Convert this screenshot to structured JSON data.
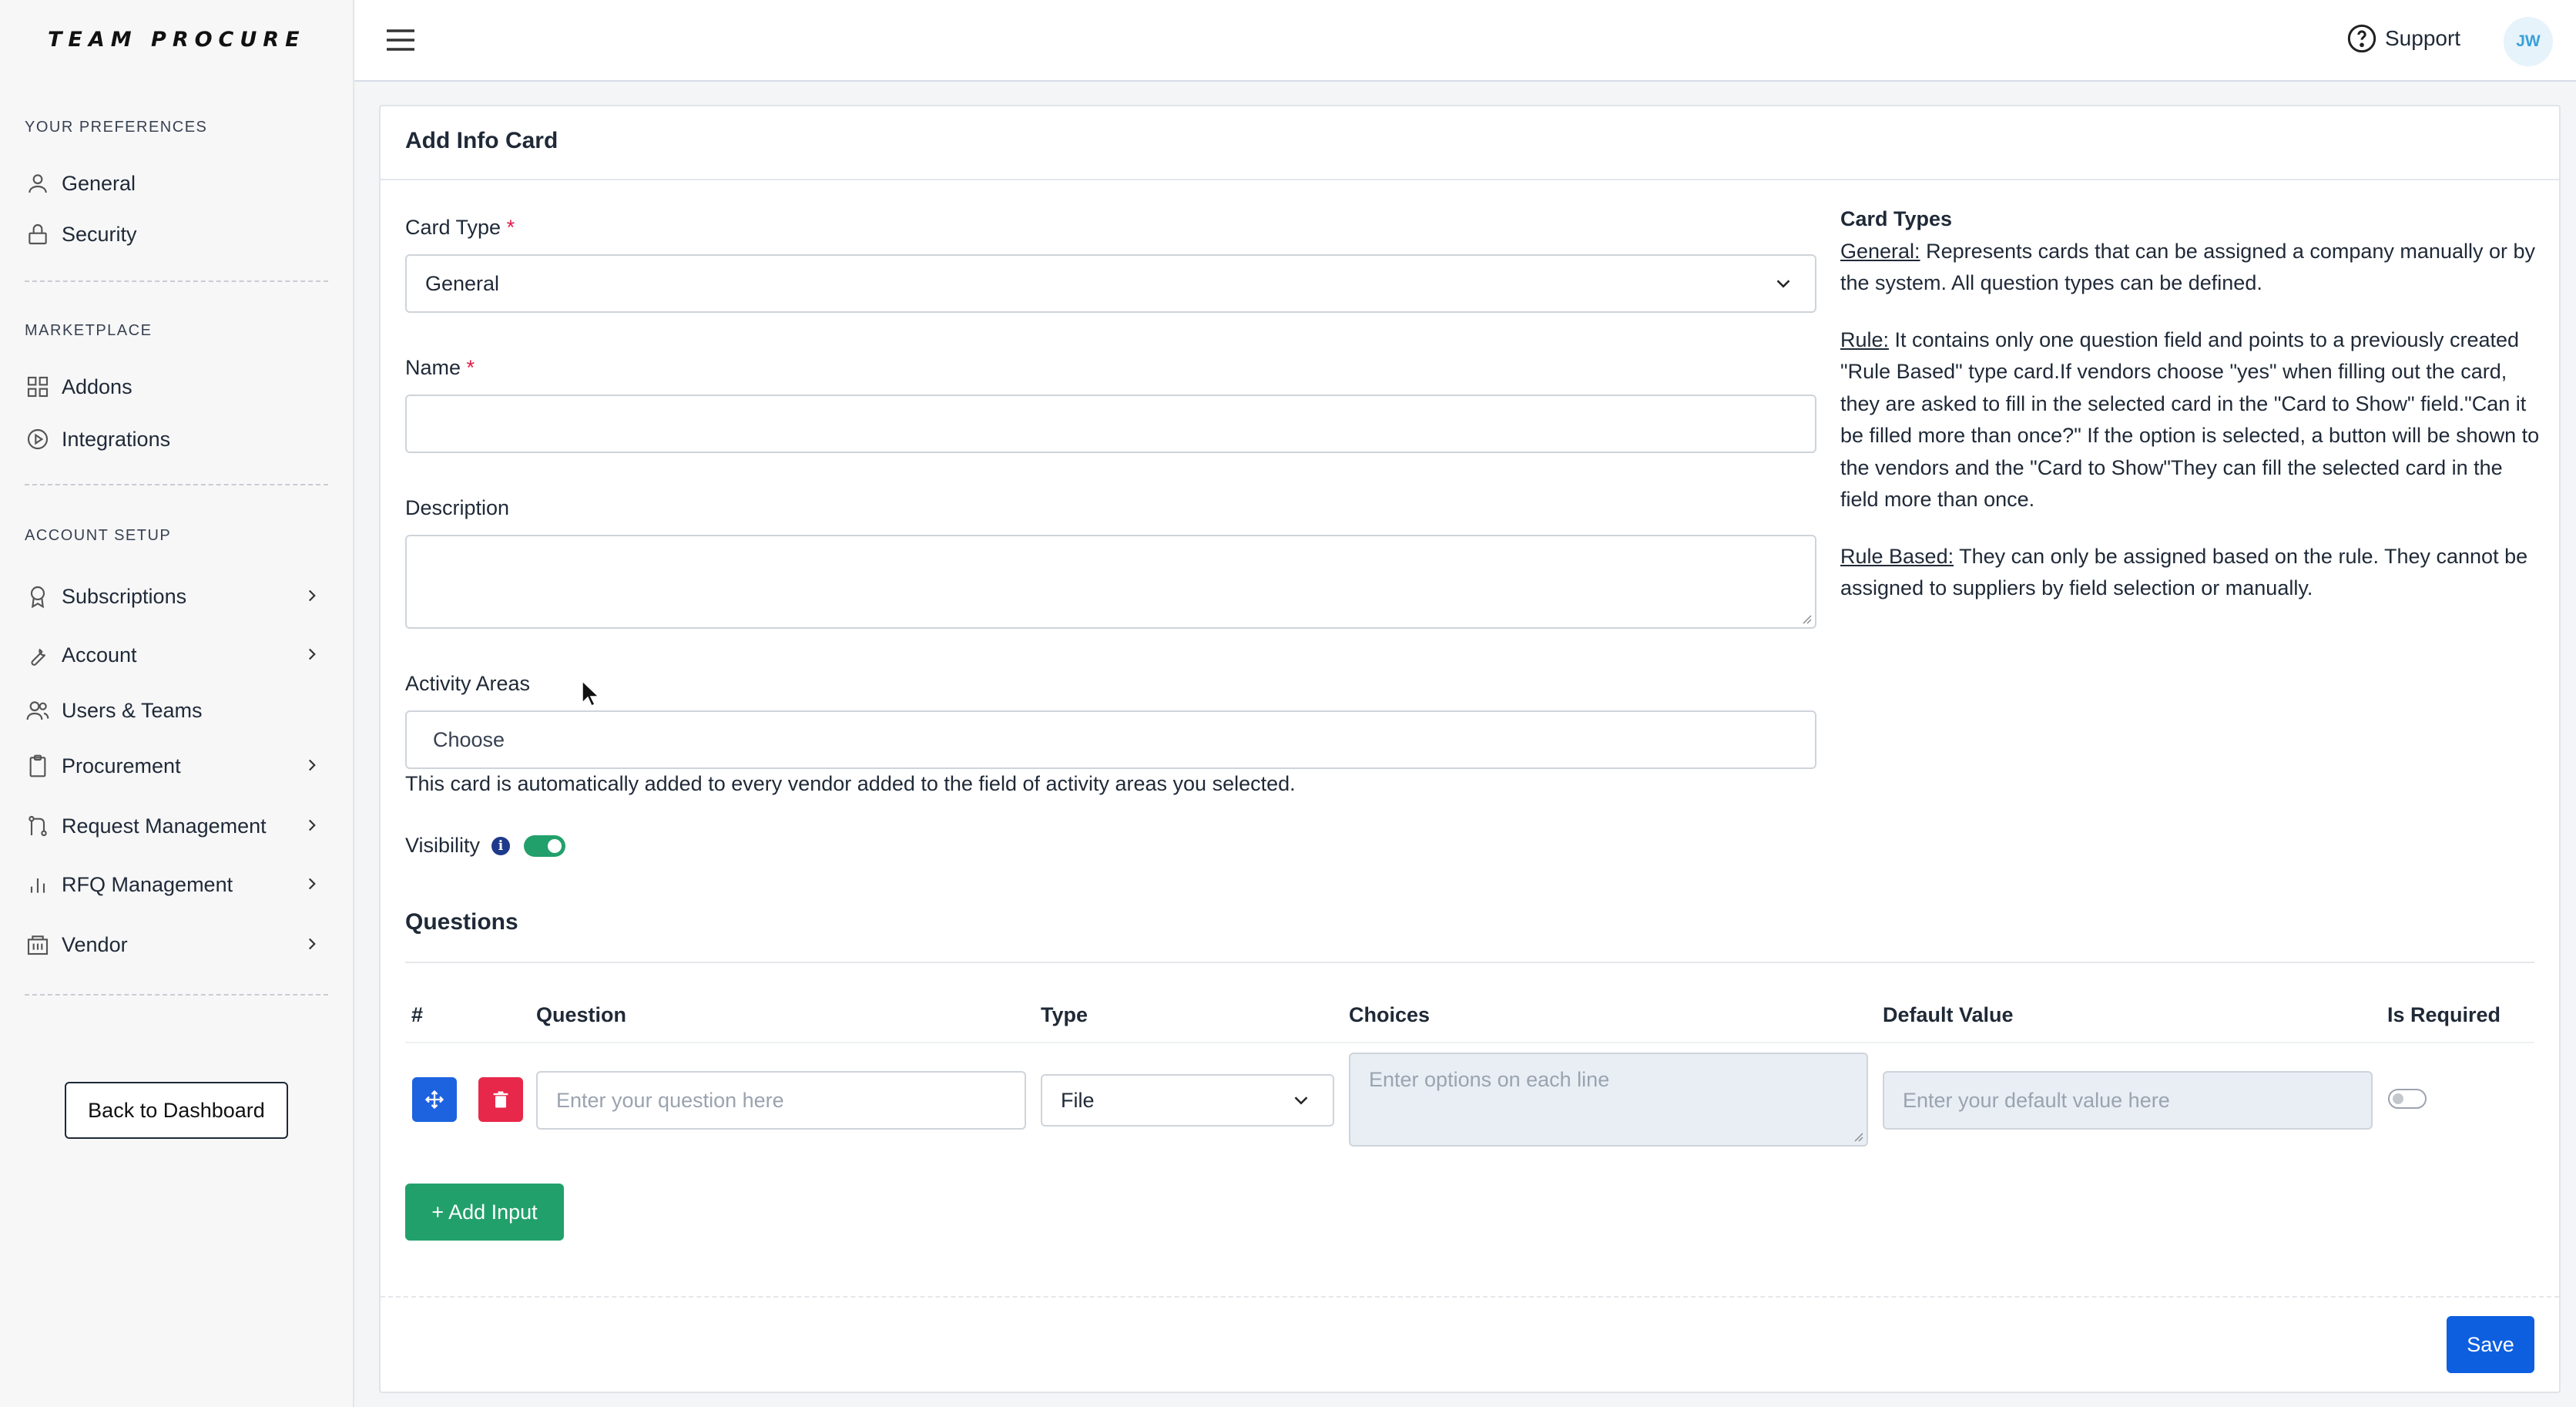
{
  "brand": {
    "logo_text": "TEAM PROCURE"
  },
  "sidebar": {
    "sections": [
      {
        "label": "YOUR PREFERENCES"
      },
      {
        "label": "MARKETPLACE"
      },
      {
        "label": "ACCOUNT SETUP"
      }
    ],
    "items": [
      {
        "label": "General",
        "icon": "user-icon"
      },
      {
        "label": "Security",
        "icon": "lock-icon"
      },
      {
        "label": "Addons",
        "icon": "grid-icon"
      },
      {
        "label": "Integrations",
        "icon": "play-circle-icon"
      },
      {
        "label": "Subscriptions",
        "icon": "award-icon",
        "has_submenu": true
      },
      {
        "label": "Account",
        "icon": "wrench-icon",
        "has_submenu": true
      },
      {
        "label": "Users & Teams",
        "icon": "users-icon"
      },
      {
        "label": "Procurement",
        "icon": "clipboard-icon",
        "has_submenu": true
      },
      {
        "label": "Request Management",
        "icon": "git-pull-icon",
        "has_submenu": true
      },
      {
        "label": "RFQ Management",
        "icon": "bar-chart-icon",
        "has_submenu": true
      },
      {
        "label": "Vendor",
        "icon": "building-icon",
        "has_submenu": true
      }
    ],
    "back_button": "Back to Dashboard"
  },
  "topbar": {
    "support_label": "Support",
    "avatar_initials": "JW"
  },
  "form": {
    "title": "Add Info Card",
    "card_type": {
      "label": "Card Type",
      "required_mark": "*",
      "value": "General"
    },
    "name": {
      "label": "Name",
      "required_mark": "*",
      "value": ""
    },
    "description": {
      "label": "Description",
      "value": ""
    },
    "activity_areas": {
      "label": "Activity Areas",
      "placeholder": "Choose",
      "hint": "This card is automatically added to every vendor added to the field of activity areas you selected."
    },
    "visibility": {
      "label": "Visibility",
      "info_glyph": "i",
      "enabled": true
    },
    "questions": {
      "title": "Questions",
      "columns": [
        "#",
        "Question",
        "Type",
        "Choices",
        "Default Value",
        "Is Required"
      ],
      "rows": [
        {
          "question_placeholder": "Enter your question here",
          "type_value": "File",
          "choices_placeholder": "Enter options on each line",
          "default_placeholder": "Enter your default value here",
          "is_required": false
        }
      ],
      "add_button": "+ Add Input"
    },
    "save_button": "Save"
  },
  "card_types_info": {
    "heading": "Card Types",
    "entries": [
      {
        "term": "General:",
        "text": " Represents cards that can be assigned a company manually or by the system. All question types can be defined."
      },
      {
        "term": "Rule:",
        "text": " It contains only one question field and points to a previously created \"Rule Based\" type card.If vendors choose \"yes\" when filling out the card, they are asked to fill in the selected card in the \"Card to Show\" field.\"Can it be filled more than once?\" If the option is selected, a button will be shown to the vendors and the \"Card to Show\"They can fill the selected card in the field more than once."
      },
      {
        "term": "Rule Based:",
        "text": " They can only be assigned based on the rule. They cannot be assigned to suppliers by field selection or manually."
      }
    ]
  },
  "colors": {
    "accent_green": "#22a06b",
    "primary_blue": "#0d5fe0",
    "danger_red": "#e8284a",
    "drag_blue": "#1d63e0"
  }
}
